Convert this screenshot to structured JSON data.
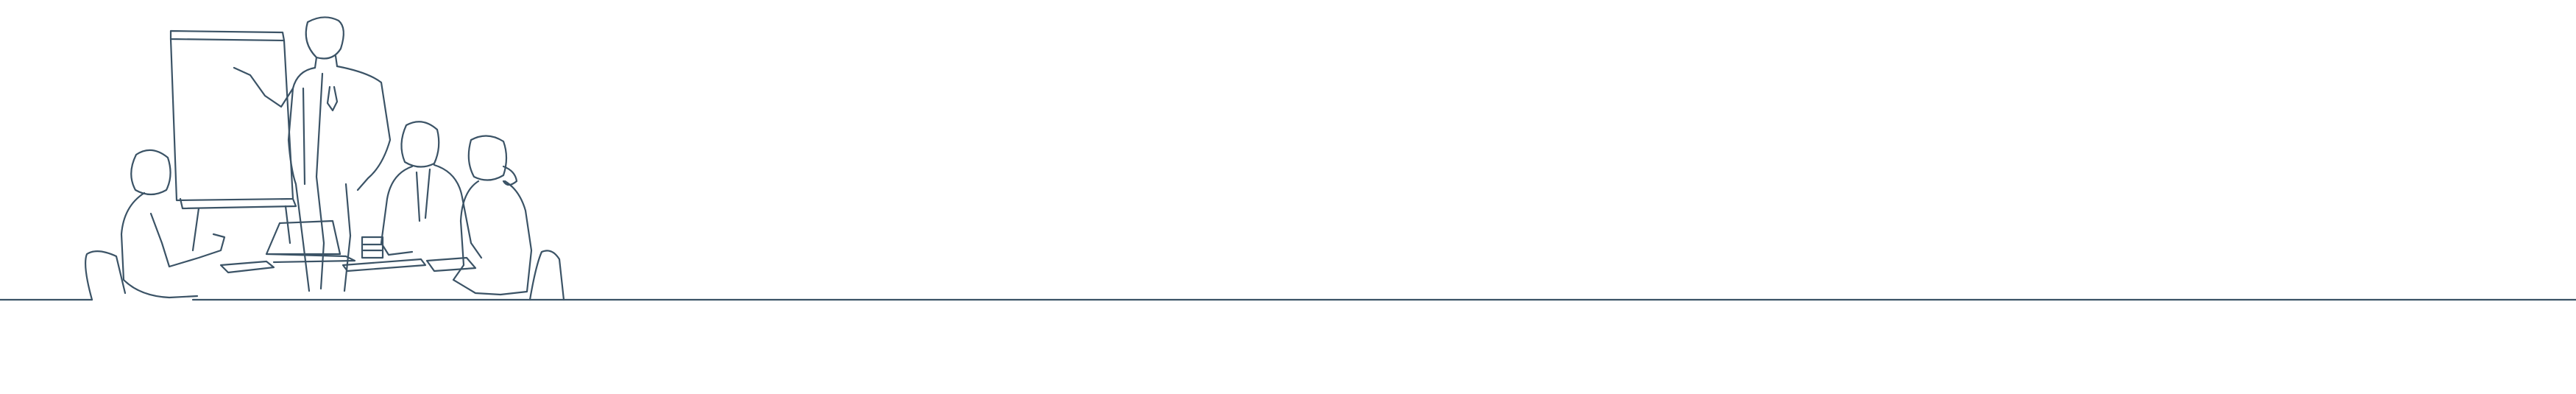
{
  "illustration": {
    "subject": "",
    "stroke_color": "#3b5366"
  }
}
